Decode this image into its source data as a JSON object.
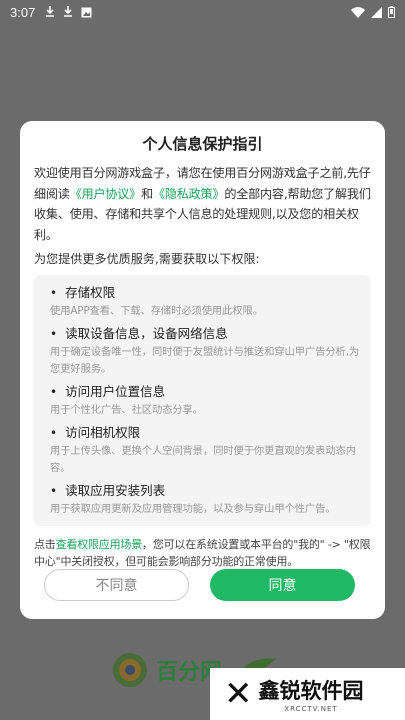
{
  "status_bar": {
    "time": "3:07",
    "left_icons": [
      "download-icon",
      "download-icon",
      "image-icon"
    ],
    "right_icons": [
      "wifi-icon",
      "signal-icon",
      "battery-icon"
    ]
  },
  "dialog": {
    "title": "个人信息保护指引",
    "intro_part1": "欢迎使用百分网游戏盒子，请您在使用百分网游戏盒子之前,先仔细阅读",
    "user_agreement_link": "《用户协议》",
    "and_text": "和",
    "privacy_policy_link": "《隐私政策》",
    "intro_part2": "的全部内容,帮助您了解我们收集、使用、存储和共享个人信息的处理规则,以及您的相关权利。",
    "perm_intro": "为您提供更多优质服务,需要获取以下权限:",
    "permissions": [
      {
        "title": "存储权限",
        "desc": "使用APP查看、下载、存储时必须使用此权限。"
      },
      {
        "title": "读取设备信息，设备网络信息",
        "desc": "用于确定设备唯一性，同时便于友盟统计与推送和穿山甲广告分析,为您更好服务。"
      },
      {
        "title": "访问用户位置信息",
        "desc": "用于个性化广告、社区动态分享。"
      },
      {
        "title": "访问相机权限",
        "desc": "用于上传头像、更换个人空间背景，同时便于你更直观的发表动态内容。"
      },
      {
        "title": "读取应用安装列表",
        "desc": "用于获取应用更新及应用管理功能，以及参与穿山甲个性广告。"
      }
    ],
    "footer_prefix": "点击",
    "footer_link": "查看权限应用场景",
    "footer_suffix": "，您可以在系统设置或本平台的\"我的\" -> \"权限中心\"中关闭授权，但可能会影响部分功能的正常使用。",
    "decline_label": "不同意",
    "agree_label": "同意"
  },
  "background_logo": {
    "text": "百分网"
  },
  "watermark": {
    "main": "鑫锐软件园",
    "sub": "XRCCTV.NET"
  },
  "colors": {
    "accent": "#1fb865",
    "link": "#1aa35a",
    "overlay": "#6b6b6b"
  }
}
